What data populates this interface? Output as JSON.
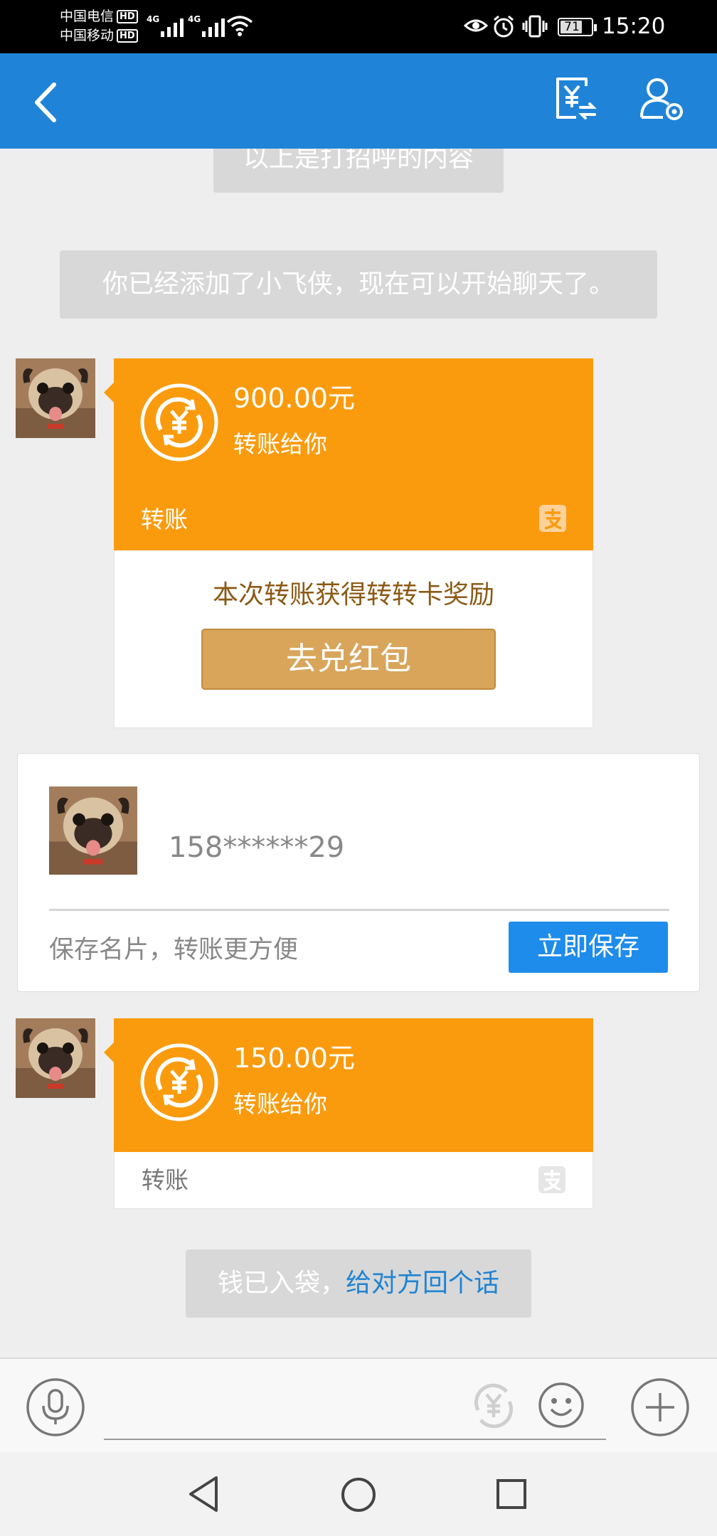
{
  "status_bar": {
    "carrier1": "中国电信",
    "carrier2": "中国移动",
    "hd": "HD",
    "network1": "4G",
    "network2": "4G",
    "battery": "71",
    "time": "15:20"
  },
  "header": {
    "back_icon": "chevron-left-icon",
    "transfer_icon": "yuan-transfer-icon",
    "settings_icon": "user-settings-icon"
  },
  "messages": {
    "system_greeting": "以上是打招呼的内容",
    "system_added": "你已经添加了小飞侠，现在可以开始聊天了。",
    "transfer1": {
      "amount": "900.00元",
      "desc": "转账给你",
      "label": "转账",
      "reward_text": "本次转账获得转转卡奖励",
      "reward_button": "去兑红包"
    },
    "card": {
      "phone": "158******29",
      "hint": "保存名片，转账更方便",
      "save_button": "立即保存"
    },
    "transfer2": {
      "amount": "150.00元",
      "desc": "转账给你",
      "label": "转账"
    },
    "system_received_prefix": "钱已入袋，",
    "system_received_link": "给对方回个话"
  },
  "input_bar": {
    "icons": [
      "microphone-icon",
      "yuan-transfer-icon",
      "emoji-icon",
      "plus-icon"
    ]
  },
  "nav_bar": {
    "icons": [
      "nav-back-icon",
      "nav-home-icon",
      "nav-recent-icon"
    ]
  },
  "colors": {
    "header_blue": "#1f84d7",
    "transfer_orange": "#fa9b0e",
    "reward_gold": "#d8a55a",
    "save_blue": "#1e8cea",
    "link_blue": "#1e84d4"
  }
}
